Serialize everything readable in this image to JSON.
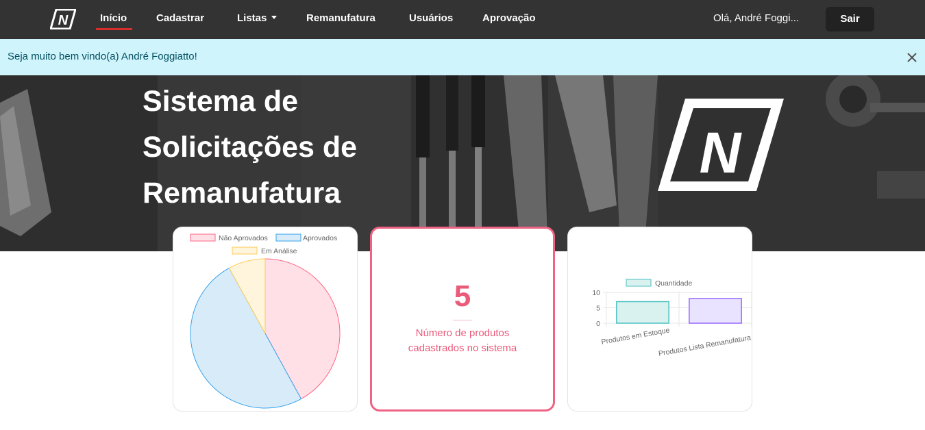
{
  "nav": {
    "items": [
      {
        "label": "Início",
        "active": true
      },
      {
        "label": "Cadastrar"
      },
      {
        "label": "Listas",
        "dropdown": true
      },
      {
        "label": "Remanufatura"
      },
      {
        "label": "Usuários"
      },
      {
        "label": "Aprovação"
      }
    ],
    "greeting": "Olá, André Foggi...",
    "logout_label": "Sair",
    "brand_letter": "N"
  },
  "alert": {
    "message": "Seja muito bem vindo(a) André Foggiatto!",
    "close_icon": "close-icon"
  },
  "hero": {
    "title": "Sistema de Solicitações de Remanufatura",
    "logo_letter": "N"
  },
  "count_card": {
    "value": "5",
    "label": "Número de produtos cadastrados no sistema"
  },
  "colors": {
    "accent": "#ef6283",
    "nav_bg": "#333333",
    "alert_bg": "#cff4fc"
  },
  "chart_data": [
    {
      "type": "pie",
      "legend": [
        "Não Aprovados",
        "Aprovados",
        "Em Análise"
      ],
      "values": [
        42,
        50,
        8
      ],
      "colors": {
        "fill": [
          "#ffe0e6",
          "#d8ebf9",
          "#fff4dc"
        ],
        "stroke": [
          "#ff6384",
          "#36a2eb",
          "#ffcd56"
        ]
      },
      "legend_position": "top"
    },
    {
      "type": "bar",
      "series": [
        {
          "name": "Quantidade",
          "values": [
            7,
            8
          ]
        }
      ],
      "categories": [
        "Produtos em Estoque",
        "Produtos Lista Remanufatura"
      ],
      "yticks": [
        "10",
        "5",
        "0"
      ],
      "ylim": [
        0,
        10
      ],
      "colors": {
        "fill": [
          "#d9f2f0",
          "#eae3ff"
        ],
        "stroke": [
          "#4bc0c0",
          "#9966ff"
        ]
      },
      "legend_position": "top",
      "grid": true
    }
  ]
}
